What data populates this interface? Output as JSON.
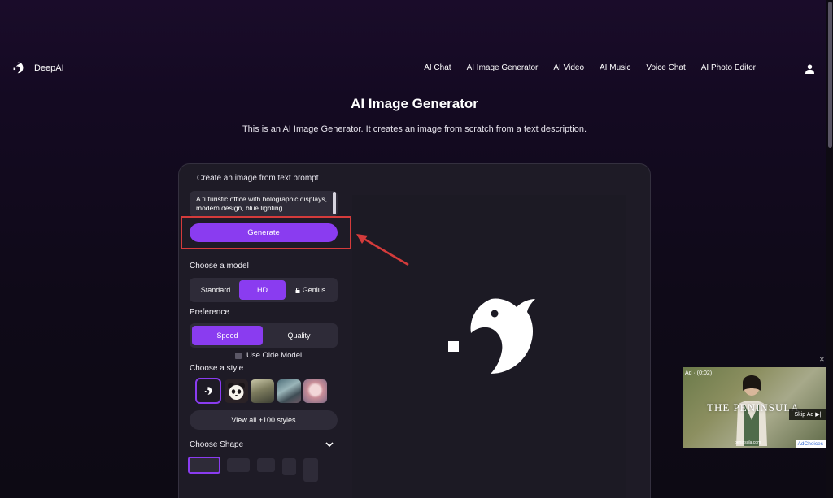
{
  "header": {
    "logo_text": "DeepAI",
    "nav": [
      "AI Chat",
      "AI Image Generator",
      "AI Video",
      "AI Music",
      "Voice Chat",
      "AI Photo Editor"
    ]
  },
  "page": {
    "title": "AI Image Generator",
    "subtitle": "This is an AI Image Generator. It creates an image from scratch from a text description."
  },
  "form": {
    "prompt_label": "Create an image from text prompt",
    "prompt_value": "A futuristic office with holographic displays, modern design, blue lighting",
    "generate_label": "Generate",
    "model_label": "Choose a model",
    "models": [
      "Standard",
      "HD",
      "Genius"
    ],
    "model_selected": "HD",
    "preference_label": "Preference",
    "preferences": [
      "Speed",
      "Quality"
    ],
    "preference_selected": "Speed",
    "olde_model_label": "Use Olde Model",
    "style_label": "Choose a style",
    "view_all_label": "View all +100 styles",
    "shape_label": "Choose Shape"
  },
  "ad": {
    "tag": "Ad · (0:02)",
    "title": "THE PENINSULA",
    "skip_label": "Skip Ad",
    "adchoices_label": "AdChoices",
    "url": "peninsula.com"
  },
  "colors": {
    "accent": "#8a3cf0",
    "panel": "#1e1b26",
    "highlight": "#d43b3b"
  }
}
